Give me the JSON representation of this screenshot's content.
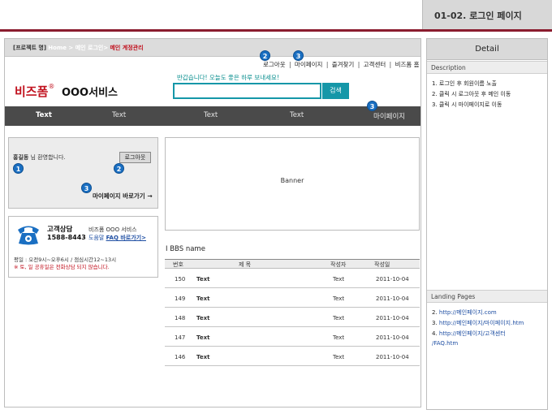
{
  "page_id": "01-02. 로그인 페이지",
  "breadcrumb": {
    "project": "[프로젝트 명]",
    "home": "Home > 메인 로그인>",
    "current": "메인 계정관리"
  },
  "util_nav": {
    "logout": "로그아웃",
    "mypage": "마이페이지",
    "favorites": "즐겨찾기",
    "cs_center": "고객센터",
    "bizform_home": "비즈폼 홈",
    "separator": "|"
  },
  "logo": {
    "brand": "비즈폼",
    "reg": "®",
    "service": "OOO서비스"
  },
  "welcome_message": "반갑습니다! 오늘도 좋은 하루 보내세요!",
  "search": {
    "placeholder": "",
    "button_label": "검색"
  },
  "gnb": [
    "Text",
    "Text",
    "Text",
    "Text",
    "마이페이지"
  ],
  "login_box": {
    "user_name": "홍길동",
    "greeting_suffix": " 님 환영합니다.",
    "logout_button": "로그아웃",
    "mypage_link": "마이페이지 바로가기 →"
  },
  "customer_center": {
    "title": "고객상담",
    "phone": "1588-8443",
    "service": "비즈폼 OOO 서비스",
    "faq_prefix": "도움말",
    "faq_link": "FAQ 바로가기>",
    "hours": "평일 : 오전9시~오후6시 / 점심시간12~13시",
    "note": "※ 토, 일 공휴일은 전화상담 되지 않습니다."
  },
  "banner": {
    "label": "Banner"
  },
  "bbs": {
    "title": "I BBS  name",
    "columns": [
      "번호",
      "제    목",
      "작성자",
      "작성일"
    ],
    "rows": [
      {
        "no": "150",
        "title": "Text",
        "author": "Text",
        "date": "2011-10-04"
      },
      {
        "no": "149",
        "title": "Text",
        "author": "Text",
        "date": "2011-10-04"
      },
      {
        "no": "148",
        "title": "Text",
        "author": "Text",
        "date": "2011-10-04"
      },
      {
        "no": "147",
        "title": "Text",
        "author": "Text",
        "date": "2011-10-04"
      },
      {
        "no": "146",
        "title": "Text",
        "author": "Text",
        "date": "2011-10-04"
      }
    ]
  },
  "markers": {
    "m1": "1",
    "m2": "2",
    "m3": "3"
  },
  "detail": {
    "title": "Detail",
    "description_label": "Description",
    "description": [
      "1.  로그인 후 회원이름 노출",
      "2.  클릭 시 로그아웃 후 메인 이동",
      "3.  클릭 시 마이페이지로 이동"
    ],
    "landing_label": "Landing Pages",
    "landing": [
      {
        "num": "2.",
        "url": "http://메인페이지.com"
      },
      {
        "num": "3.",
        "url": "http://메인페이지/마이페이지.htm"
      },
      {
        "num": "4.",
        "url": "http://메인페이지/고객센터"
      }
    ],
    "landing_cont": "/FAQ.htm"
  },
  "colors": {
    "accent_red": "#c1121f",
    "rule": "#8a1c2e",
    "teal": "#1597a8",
    "gnb_bg": "#4a4a4a",
    "marker_blue": "#1a6fc2"
  },
  "icons": {
    "phone": "telephone-icon"
  }
}
